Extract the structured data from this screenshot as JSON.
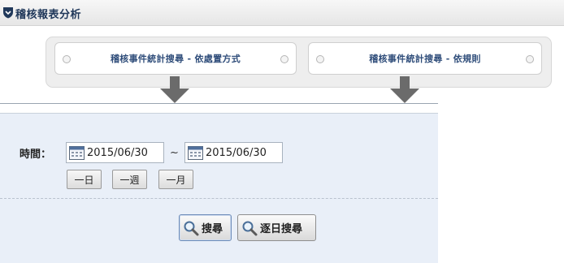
{
  "header": {
    "title": "稽核報表分析"
  },
  "tabs": [
    {
      "label": "稽核事件統計搜尋 - 依處置方式"
    },
    {
      "label": "稽核事件統計搜尋 - 依規則"
    }
  ],
  "form": {
    "time_label": "時間：",
    "date_from": "2015/06/30",
    "date_to": "2015/06/30",
    "range_separator": "~",
    "quick_ranges": [
      "一日",
      "一週",
      "一月"
    ],
    "search_label": "搜尋",
    "daily_search_label": "逐日搜尋"
  },
  "colors": {
    "brand": "#20385a",
    "tab_text": "#2f4d7a",
    "panel_bg": "#e9eff8"
  },
  "icons": [
    "shield-icon",
    "calendar-icon",
    "down-arrow-icon",
    "magnifier-icon",
    "radio-dot-icon"
  ]
}
